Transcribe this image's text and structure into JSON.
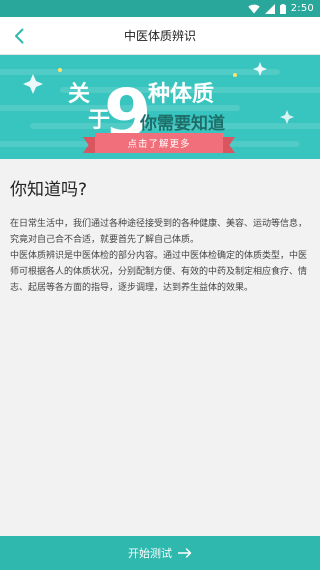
{
  "status_bar": {
    "time": "2:50"
  },
  "header": {
    "title": "中医体质辨识"
  },
  "banner": {
    "word_guan": "关",
    "word_yu": "于",
    "number": "9",
    "line1_rest": "种体质",
    "line2": "你需要知道",
    "cta": "点击了解更多",
    "colors": {
      "background": "#38c4bf",
      "ribbon": "#f06f7a"
    }
  },
  "content": {
    "title": "你知道吗?",
    "paragraphs": [
      "在日常生活中，我们通过各种途径接受到的各种健康、美容、运动等信息，究竟对自己合不合适，就要首先了解自己体质。",
      "中医体质辨识是中医体检的部分内容。通过中医体检确定的体质类型，中医师可根据各人的体质状况，分别配制方便、有效的中药及制定相应食疗、情志、起居等各方面的指导，逐步调理，达到养生益体的效果。"
    ]
  },
  "footer": {
    "start_label": "开始测试"
  },
  "icons": [
    "back-chevron-icon",
    "wifi-icon",
    "signal-icon",
    "battery-icon",
    "arrow-right-icon"
  ],
  "theme": {
    "accent": "#2fb8ad",
    "status_bar": "#2aa79b"
  }
}
